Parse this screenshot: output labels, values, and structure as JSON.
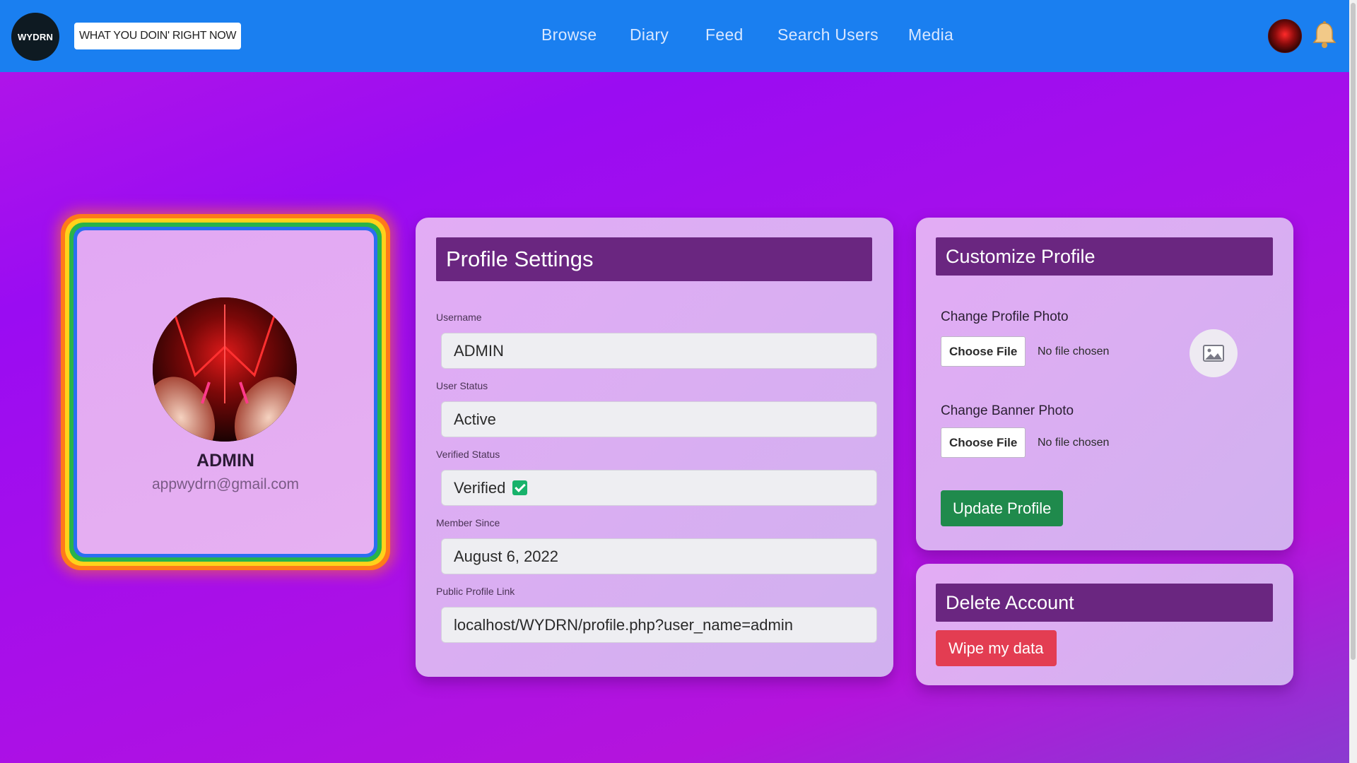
{
  "header": {
    "logo_text": "WYDRN",
    "tagline": "WHAT YOU DOIN' RIGHT NOW",
    "nav": {
      "browse": "Browse",
      "diary": "Diary",
      "feed": "Feed",
      "search_users": "Search Users",
      "media": "Media"
    },
    "avatar_icon": "user-avatar",
    "bell_icon": "bell-icon"
  },
  "profile_card": {
    "name": "ADMIN",
    "email": "appwydrn@gmail.com",
    "frame_colors": [
      "#ff7a1a",
      "#ffd21a",
      "#29b34a",
      "#2a6ff0"
    ]
  },
  "settings": {
    "title": "Profile Settings",
    "username_label": "Username",
    "username": "ADMIN",
    "status_label": "User Status",
    "status": "Active",
    "verified_label": "Verified Status",
    "verified": "Verified",
    "member_label": "Member Since",
    "member_since": "August 6, 2022",
    "link_label": "Public Profile Link",
    "link": "localhost/WYDRN/profile.php?user_name=admin"
  },
  "customize": {
    "title": "Customize Profile",
    "profile_photo_label": "Change Profile Photo",
    "banner_photo_label": "Change Banner Photo",
    "choose_file": "Choose File",
    "no_file": "No file chosen",
    "update_button": "Update Profile"
  },
  "delete": {
    "title": "Delete Account",
    "wipe_button": "Wipe my data"
  },
  "colors": {
    "header": "#1a7ff0",
    "section_header": "#6a2680",
    "update": "#1f8a4c",
    "wipe": "#e33d52",
    "verified_check": "#18b26b"
  }
}
